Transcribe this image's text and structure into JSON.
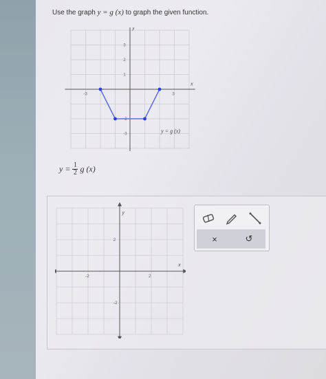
{
  "question": {
    "prefix": "Use the graph ",
    "math": "y = g (x)",
    "suffix": " to graph the given function."
  },
  "given_graph": {
    "axis_x_label": "x",
    "axis_y_label": "y",
    "x_ticks": [
      "-3",
      "3"
    ],
    "y_ticks": [
      "3",
      "2",
      "1",
      "-2",
      "-3"
    ],
    "curve_label": "y = g (x)",
    "points": [
      [
        -2,
        0
      ],
      [
        -1,
        -2
      ],
      [
        1,
        -2
      ],
      [
        2,
        0
      ]
    ],
    "line_color": "#5b6ee8"
  },
  "target_function": {
    "lhs": "y =",
    "numerator": "1",
    "denominator": "2",
    "rhs": "g (x)"
  },
  "answer_graph": {
    "axis_x_label": "x",
    "axis_y_label": "y",
    "x_ticks": [
      "-2",
      "2"
    ],
    "y_ticks": [
      "2",
      "-2"
    ]
  },
  "toolbox": {
    "tools": [
      "eraser-icon",
      "pencil-icon",
      "line-segment-icon"
    ],
    "clear_label": "×",
    "undo_label": "↺"
  }
}
